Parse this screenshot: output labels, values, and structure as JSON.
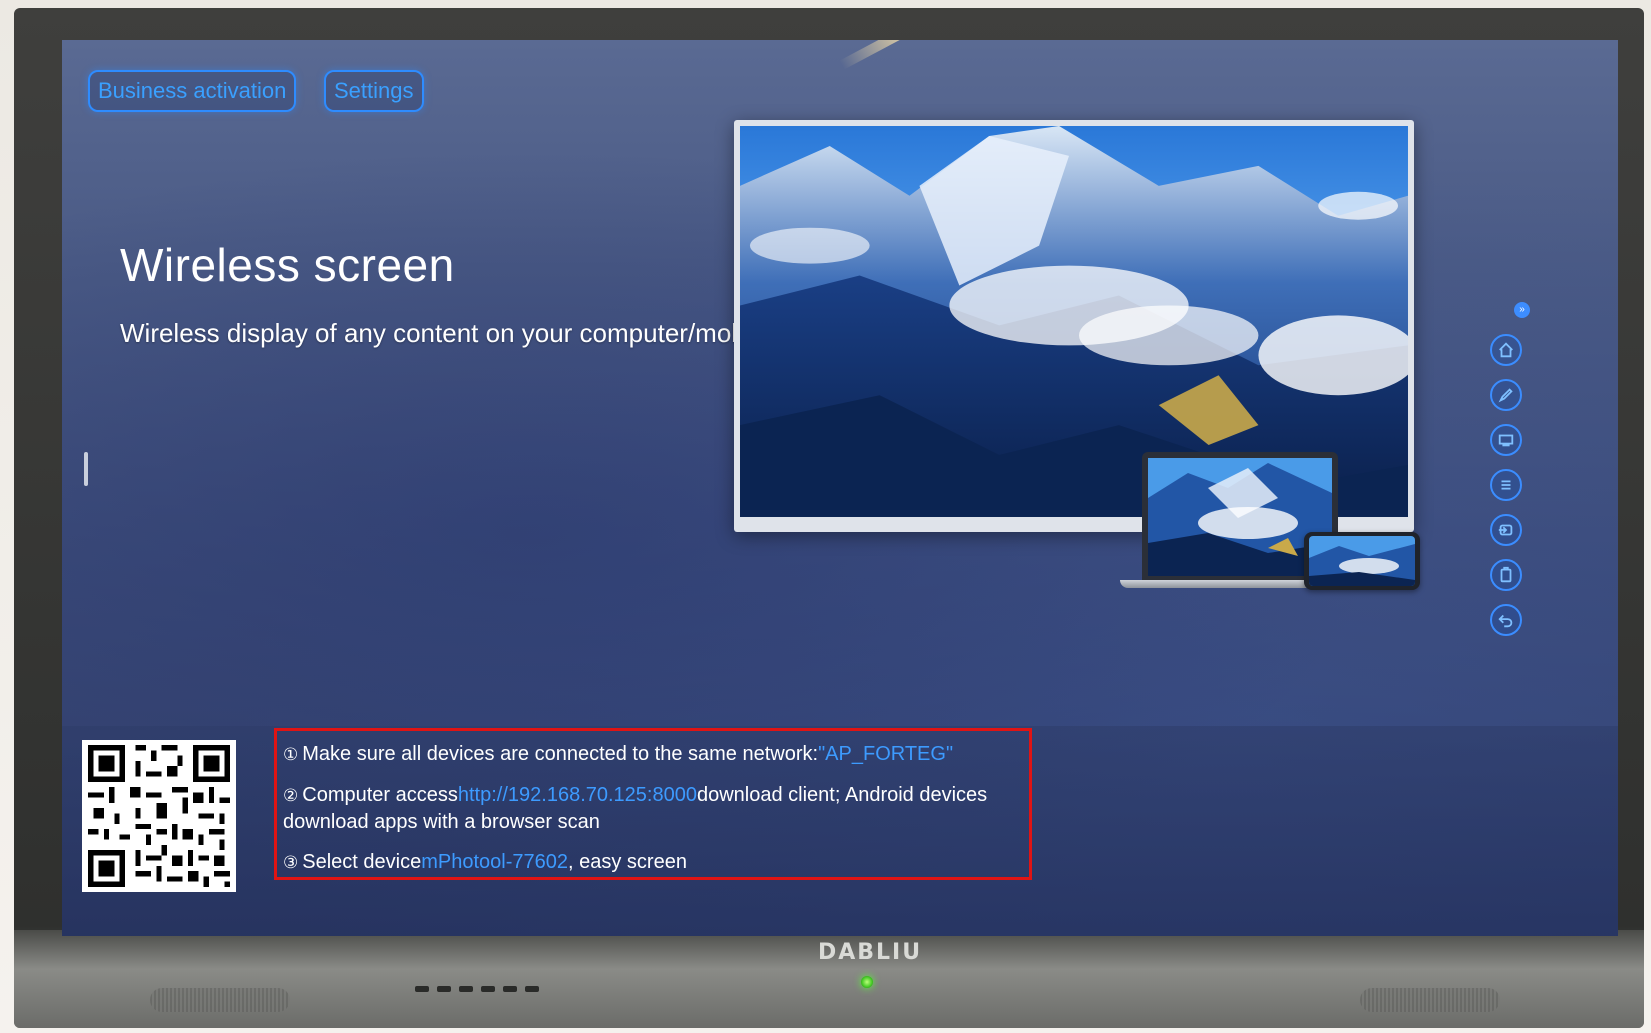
{
  "header": {
    "business_activation_label": "Business activation",
    "settings_label": "Settings"
  },
  "hero": {
    "title": "Wireless screen",
    "subtitle": "Wireless display of any content on your computer/mobile phone"
  },
  "steps": [
    {
      "number": "①",
      "text_before": "Make sure all devices are connected to the same network:",
      "highlight": "\"AP_FORTEG\"",
      "text_after": ""
    },
    {
      "number": "②",
      "text_before": "Computer access",
      "highlight": "http://192.168.70.125:8000",
      "text_after": "download client; Android devices download apps with a browser scan"
    },
    {
      "number": "③",
      "text_before": "Select device",
      "highlight": "mPhotool-77602",
      "text_after": ", easy screen"
    }
  ],
  "monitor": {
    "brand": "DABLIU"
  },
  "toolbar": {
    "collapse_glyph": "»",
    "items": [
      {
        "icon": "home-icon"
      },
      {
        "icon": "pen-icon"
      },
      {
        "icon": "screen-icon"
      },
      {
        "icon": "list-icon"
      },
      {
        "icon": "input-source-icon"
      },
      {
        "icon": "clipboard-icon"
      },
      {
        "icon": "back-icon"
      }
    ]
  },
  "colors": {
    "accent": "#3d9bff",
    "highlight_box": "#e01414",
    "screen_background": "#3b4a78"
  }
}
